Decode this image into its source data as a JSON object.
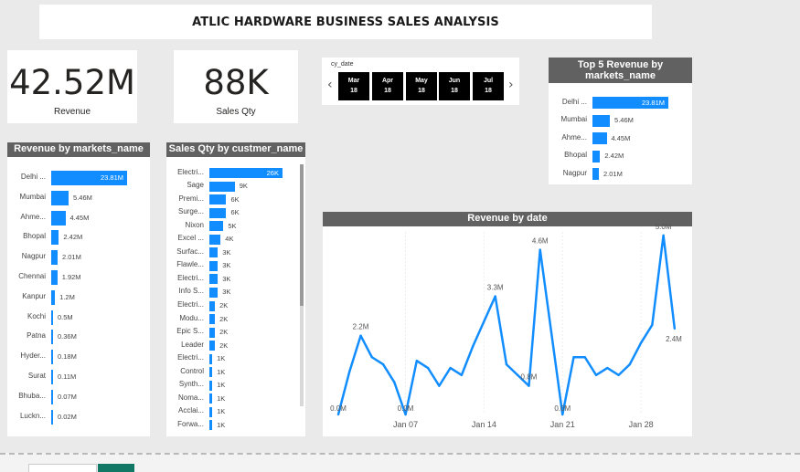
{
  "title": "ATLIC HARDWARE BUSINESS SALES ANALYSIS",
  "kpis": {
    "revenue": {
      "value": "42.52M",
      "label": "Revenue"
    },
    "sales_qty": {
      "value": "88K",
      "label": "Sales Qty"
    }
  },
  "date_slicer": {
    "label": "cy_date",
    "tiles": [
      {
        "month": "Mar",
        "year": "18"
      },
      {
        "month": "Apr",
        "year": "18"
      },
      {
        "month": "May",
        "year": "18"
      },
      {
        "month": "Jun",
        "year": "18"
      },
      {
        "month": "Jul",
        "year": "18"
      }
    ],
    "prev_glyph": "‹",
    "next_glyph": "›"
  },
  "colors": {
    "bar": "#118dff",
    "header": "#616161",
    "accent_tab": "#117865"
  },
  "chart_data": [
    {
      "id": "top5",
      "type": "bar",
      "title": "Top 5 Revenue by markets_name",
      "categories": [
        "Delhi ...",
        "Mumbai",
        "Ahme...",
        "Bhopal",
        "Nagpur"
      ],
      "values": [
        23.81,
        5.46,
        4.45,
        2.42,
        2.01
      ],
      "value_labels": [
        "23.81M",
        "5.46M",
        "4.45M",
        "2.42M",
        "2.01M"
      ]
    },
    {
      "id": "revenue_markets",
      "type": "bar",
      "title": "Revenue by markets_name",
      "categories": [
        "Delhi ...",
        "Mumbai",
        "Ahme...",
        "Bhopal",
        "Nagpur",
        "Chennai",
        "Kanpur",
        "Kochi",
        "Patna",
        "Hyder...",
        "Surat",
        "Bhuba...",
        "Luckn..."
      ],
      "values": [
        23.81,
        5.46,
        4.45,
        2.42,
        2.01,
        1.92,
        1.2,
        0.5,
        0.36,
        0.18,
        0.11,
        0.07,
        0.02
      ],
      "value_labels": [
        "23.81M",
        "5.46M",
        "4.45M",
        "2.42M",
        "2.01M",
        "1.92M",
        "1.2M",
        "0.5M",
        "0.36M",
        "0.18M",
        "0.11M",
        "0.07M",
        "0.02M"
      ]
    },
    {
      "id": "qty_customers",
      "type": "bar",
      "title": "Sales Qty by custmer_name",
      "categories": [
        "Electri...",
        "Sage",
        "Premi...",
        "Surge...",
        "Nixon",
        "Excel ...",
        "Surfac...",
        "Flawle...",
        "Electri...",
        "Info S...",
        "Electri...",
        "Modu...",
        "Epic S...",
        "Leader",
        "Electri...",
        "Control",
        "Synth...",
        "Noma...",
        "Acclai...",
        "Forwa..."
      ],
      "values": [
        26,
        9,
        6,
        6,
        5,
        4,
        3,
        3,
        3,
        3,
        2,
        2,
        2,
        2,
        1,
        1,
        1,
        1,
        1,
        1
      ],
      "value_labels": [
        "26K",
        "9K",
        "6K",
        "6K",
        "5K",
        "4K",
        "3K",
        "3K",
        "3K",
        "3K",
        "2K",
        "2K",
        "2K",
        "2K",
        "1K",
        "1K",
        "1K",
        "1K",
        "1K",
        "1K"
      ]
    },
    {
      "id": "revenue_date",
      "type": "line",
      "title": "Revenue by date",
      "x_ticks": [
        "Jan 07",
        "Jan 14",
        "Jan 21",
        "Jan 28"
      ],
      "x_tick_days": [
        7,
        14,
        21,
        28
      ],
      "xlim": [
        1,
        31.5
      ],
      "ylim": [
        0,
        5.1
      ],
      "x": [
        1,
        2,
        3,
        4,
        5,
        6,
        7,
        8,
        9,
        10,
        11,
        12,
        13,
        14,
        15,
        16,
        17,
        18,
        19,
        20,
        21,
        22,
        23,
        24,
        25,
        26,
        27,
        28,
        29,
        30,
        31,
        32
      ],
      "values": [
        0.0,
        1.2,
        2.2,
        1.6,
        1.4,
        0.9,
        0.0,
        1.5,
        1.3,
        0.8,
        1.3,
        1.1,
        1.9,
        2.6,
        3.3,
        1.4,
        1.1,
        0.8,
        4.6,
        2.3,
        0.0,
        1.6,
        1.6,
        1.1,
        1.3,
        1.1,
        1.4,
        2.0,
        2.5,
        5.0,
        2.4
      ],
      "data_labels": [
        {
          "index": 0,
          "text": "0.0M"
        },
        {
          "index": 2,
          "text": "2.2M"
        },
        {
          "index": 6,
          "text": "0.0M"
        },
        {
          "index": 14,
          "text": "3.3M"
        },
        {
          "index": 17,
          "text": "0.8M"
        },
        {
          "index": 18,
          "text": "4.6M"
        },
        {
          "index": 20,
          "text": "0.0M"
        },
        {
          "index": 29,
          "text": "5.0M"
        },
        {
          "index": 30,
          "text": "2.4M"
        }
      ]
    }
  ]
}
